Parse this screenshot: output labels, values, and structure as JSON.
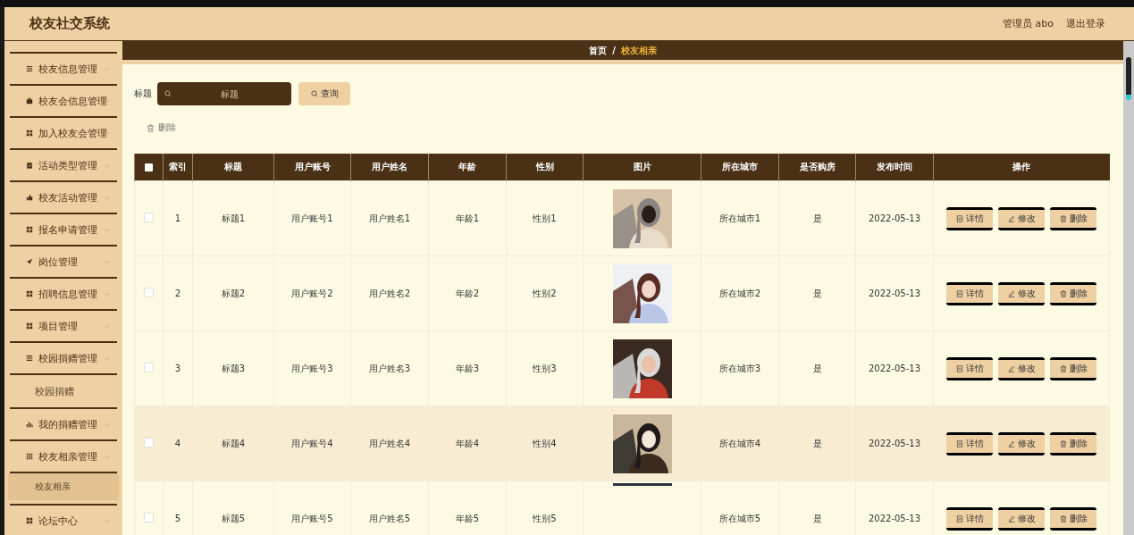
{
  "header": {
    "title": "校友社交系统",
    "user": "管理员 abo",
    "logout": "退出登录"
  },
  "sidebar": {
    "items": [
      {
        "label": "校友信息管理"
      },
      {
        "label": "校友会信息管理"
      },
      {
        "label": "加入校友会管理"
      },
      {
        "label": "活动类型管理"
      },
      {
        "label": "校友活动管理"
      },
      {
        "label": "报名申请管理"
      },
      {
        "label": "岗位管理"
      },
      {
        "label": "招聘信息管理"
      },
      {
        "label": "项目管理"
      },
      {
        "label": "校园捐赠管理",
        "children": [
          {
            "label": "校园捐赠",
            "selected": false
          }
        ]
      },
      {
        "label": "我的捐赠管理"
      },
      {
        "label": "校友相亲管理",
        "children": [
          {
            "label": "校友相亲",
            "selected": true
          }
        ]
      },
      {
        "label": "论坛中心"
      }
    ]
  },
  "breadcrumb": [
    {
      "label": "首页",
      "selected": false
    },
    {
      "label": "校友相亲",
      "selected": true
    }
  ],
  "breadcrumb_separator": "/",
  "search": {
    "label": "标题",
    "placeholder": "标题",
    "button": "查询"
  },
  "toolbar": {
    "delete": "删除"
  },
  "table": {
    "all_checked": false,
    "columns": [
      "索引",
      "标题",
      "用户账号",
      "用户姓名",
      "年龄",
      "性别",
      "图片",
      "所在城市",
      "是否购房",
      "发布时间",
      "操作"
    ],
    "rows": [
      {
        "index": "1",
        "title": "标题1",
        "account": "用户账号1",
        "name": "用户姓名1",
        "age": "年龄1",
        "gender": "性别1",
        "city": "所在城市1",
        "house": "是",
        "date": "2022-05-13",
        "checked": false,
        "highlighted": false,
        "actions": [
          "详情",
          "修改",
          "删除"
        ]
      },
      {
        "index": "2",
        "title": "标题2",
        "account": "用户账号2",
        "name": "用户姓名2",
        "age": "年龄2",
        "gender": "性别2",
        "city": "所在城市2",
        "house": "是",
        "date": "2022-05-13",
        "checked": false,
        "highlighted": false,
        "actions": [
          "详情",
          "修改",
          "删除"
        ]
      },
      {
        "index": "3",
        "title": "标题3",
        "account": "用户账号3",
        "name": "用户姓名3",
        "age": "年龄3",
        "gender": "性别3",
        "city": "所在城市3",
        "house": "是",
        "date": "2022-05-13",
        "checked": false,
        "highlighted": false,
        "actions": [
          "详情",
          "修改",
          "删除"
        ]
      },
      {
        "index": "4",
        "title": "标题4",
        "account": "用户账号4",
        "name": "用户姓名4",
        "age": "年龄4",
        "gender": "性别4",
        "city": "所在城市4",
        "house": "是",
        "date": "2022-05-13",
        "checked": false,
        "highlighted": true,
        "actions": [
          "详情",
          "修改",
          "删除"
        ]
      },
      {
        "index": "5",
        "title": "标题5",
        "account": "用户账号5",
        "name": "用户姓名5",
        "age": "年龄5",
        "gender": "性别5",
        "image": {
          "kind": "loading"
        },
        "city": "所在城市5",
        "house": "是",
        "date": "2022-05-13",
        "checked": false,
        "highlighted": false,
        "actions": [
          "详情",
          "修改",
          "删除"
        ]
      }
    ]
  }
}
